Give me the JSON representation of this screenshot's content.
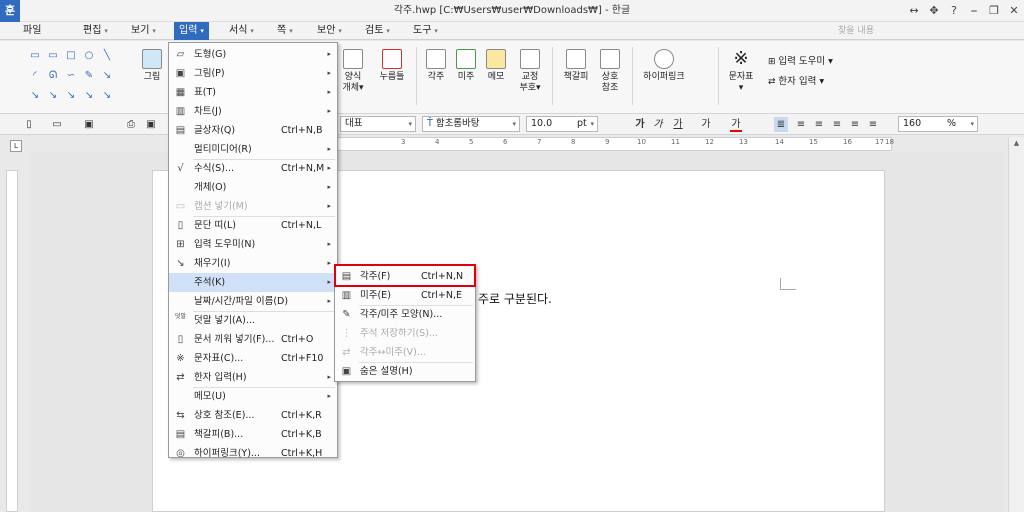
{
  "app": {
    "logo": "훈",
    "title": "각주.hwp [C:₩Users₩user₩Downloads₩] - 한글"
  },
  "window_controls": [
    "↔",
    "✥",
    "?",
    "⎯",
    "❐",
    "✕"
  ],
  "menubar": {
    "items": [
      {
        "label": "파일",
        "arrow": ""
      },
      {
        "label": "편집",
        "arrow": "▾"
      },
      {
        "label": "보기",
        "arrow": "▾"
      },
      {
        "label": "입력",
        "arrow": "▾"
      },
      {
        "label": "서식",
        "arrow": "▾"
      },
      {
        "label": "쪽",
        "arrow": "▾"
      },
      {
        "label": "보안",
        "arrow": "▾"
      },
      {
        "label": "검토",
        "arrow": "▾"
      },
      {
        "label": "도구",
        "arrow": "▾"
      }
    ],
    "search_placeholder": "찾을 내용"
  },
  "ribbon": {
    "picture_label": "그림",
    "buttons": [
      {
        "label": "양식\n개체▾",
        "icon": "form-icon"
      },
      {
        "label": "누름틀",
        "icon": "field-icon"
      },
      {
        "label": "각주",
        "icon": "footnote-icon"
      },
      {
        "label": "미주",
        "icon": "endnote-icon"
      },
      {
        "label": "메모",
        "icon": "memo-icon"
      },
      {
        "label": "교정\n부호▾",
        "icon": "proofread-icon"
      },
      {
        "label": "책갈피",
        "icon": "bookmark-icon"
      },
      {
        "label": "상호\n참조",
        "icon": "cross-reference-icon"
      },
      {
        "label": "하이퍼링크",
        "icon": "hyperlink-icon"
      },
      {
        "label": "문자표\n▾",
        "icon": "symbol-icon"
      }
    ],
    "input_helper": "입력 도우미 ▾",
    "hanja_input": "한자 입력 ▾"
  },
  "fmtbar": {
    "style": "대표",
    "font": "함초롬바탕",
    "size": "10.0",
    "size_unit": "pt",
    "char_buttons": [
      "가",
      "가",
      "가",
      "가",
      "가"
    ],
    "zoom": "160",
    "zoom_unit": "%"
  },
  "ruler": {
    "ticks": [
      "3",
      "4",
      "5",
      "6",
      "7",
      "8",
      "9",
      "10",
      "11",
      "12",
      "13",
      "14",
      "15",
      "16",
      "17",
      "18"
    ]
  },
  "document": {
    "text": "주로 구분된다."
  },
  "insert_menu": {
    "items": [
      {
        "icon": "▱",
        "label": "도형(G)",
        "shortcut": "",
        "sub": "▸",
        "disabled": false
      },
      {
        "icon": "▣",
        "label": "그림(P)",
        "shortcut": "",
        "sub": "▸",
        "disabled": false
      },
      {
        "icon": "▦",
        "label": "표(T)",
        "shortcut": "",
        "sub": "▸",
        "disabled": false
      },
      {
        "icon": "▥",
        "label": "차트(J)",
        "shortcut": "",
        "sub": "▸",
        "disabled": false
      },
      {
        "icon": "▤",
        "label": "글상자(Q)",
        "shortcut": "Ctrl+N,B",
        "sub": "",
        "disabled": false
      },
      {
        "icon": "",
        "label": "멀티미디어(R)",
        "shortcut": "",
        "sub": "▸",
        "disabled": false
      },
      {
        "icon": "√",
        "label": "수식(S)...",
        "shortcut": "Ctrl+N,M",
        "sub": "▸",
        "disabled": false
      },
      {
        "icon": "",
        "label": "개체(O)",
        "shortcut": "",
        "sub": "▸",
        "disabled": false
      },
      {
        "icon": "▭",
        "label": "캡션 넣기(M)",
        "shortcut": "",
        "sub": "▸",
        "disabled": true
      },
      {
        "icon": "▯",
        "label": "문단 띠(L)",
        "shortcut": "Ctrl+N,L",
        "sub": "",
        "disabled": false
      },
      {
        "icon": "⊞",
        "label": "입력 도우미(N)",
        "shortcut": "",
        "sub": "▸",
        "disabled": false
      },
      {
        "icon": "↘",
        "label": "채우기(I)",
        "shortcut": "",
        "sub": "▸",
        "disabled": false
      },
      {
        "icon": "",
        "label": "주석(K)",
        "shortcut": "",
        "sub": "▸",
        "disabled": false,
        "highlight": true
      },
      {
        "icon": "",
        "label": "날짜/시간/파일 이름(D)",
        "shortcut": "",
        "sub": "▸",
        "disabled": false
      },
      {
        "icon": "덧말",
        "label": "덧말 넣기(A)...",
        "shortcut": "",
        "sub": "",
        "disabled": false
      },
      {
        "icon": "▯",
        "label": "문서 끼워 넣기(F)...",
        "shortcut": "Ctrl+O",
        "sub": "",
        "disabled": false
      },
      {
        "icon": "※",
        "label": "문자표(C)...",
        "shortcut": "Ctrl+F10",
        "sub": "",
        "disabled": false
      },
      {
        "icon": "⇄",
        "label": "한자 입력(H)",
        "shortcut": "",
        "sub": "▸",
        "disabled": false
      },
      {
        "icon": "",
        "label": "메모(U)",
        "shortcut": "",
        "sub": "▸",
        "disabled": false
      },
      {
        "icon": "⇆",
        "label": "상호 참조(E)...",
        "shortcut": "Ctrl+K,R",
        "sub": "",
        "disabled": false
      },
      {
        "icon": "▤",
        "label": "책갈피(B)...",
        "shortcut": "Ctrl+K,B",
        "sub": "",
        "disabled": false
      },
      {
        "icon": "◎",
        "label": "하이퍼링크(Y)...",
        "shortcut": "Ctrl+K,H",
        "sub": "",
        "disabled": false
      }
    ]
  },
  "annotation_menu": {
    "items": [
      {
        "icon": "▤",
        "label": "각주(F)",
        "shortcut": "Ctrl+N,N",
        "disabled": false
      },
      {
        "icon": "▥",
        "label": "미주(E)",
        "shortcut": "Ctrl+N,E",
        "disabled": false
      },
      {
        "icon": "✎",
        "label": "각주/미주 모양(N)...",
        "shortcut": "",
        "disabled": false
      },
      {
        "icon": "⋮",
        "label": "주석 저장하기(S)...",
        "shortcut": "",
        "disabled": true
      },
      {
        "icon": "⇄",
        "label": "각주↔미주(V)...",
        "shortcut": "",
        "disabled": true
      },
      {
        "icon": "▣",
        "label": "숨은 설명(H)",
        "shortcut": "",
        "disabled": false
      }
    ]
  }
}
